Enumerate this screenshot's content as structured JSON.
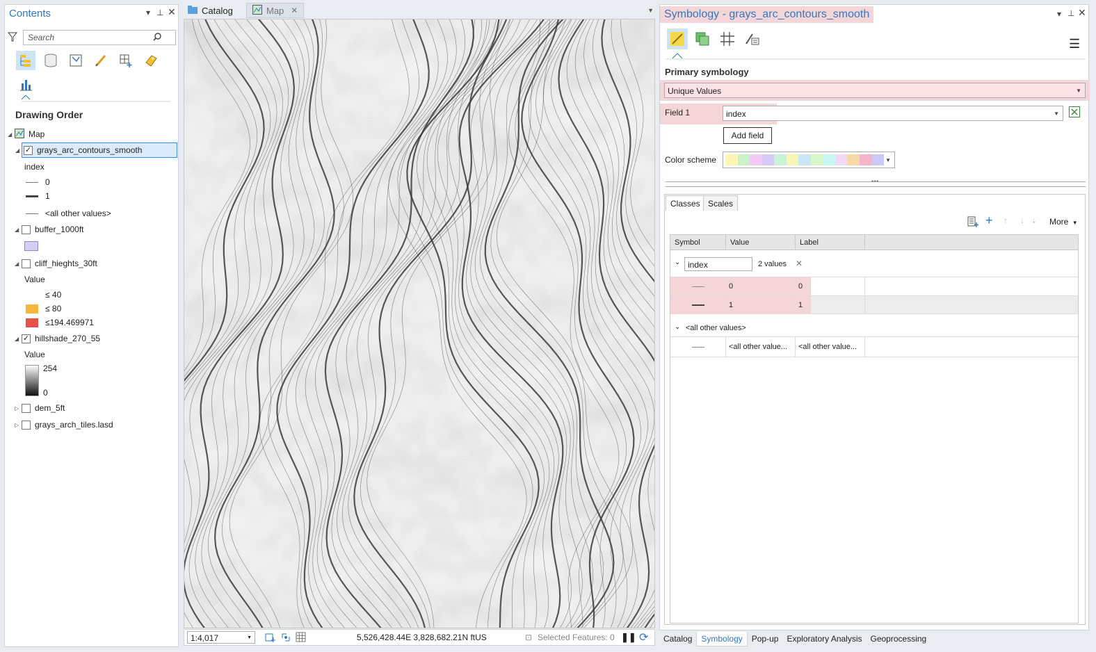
{
  "contents": {
    "title": "Contents",
    "search_placeholder": "Search",
    "section": "Drawing Order",
    "map_label": "Map",
    "layers": {
      "contours": {
        "name": "grays_arc_contours_smooth",
        "field": "index",
        "classes": [
          "0",
          "1",
          "<all other values>"
        ]
      },
      "buffer": {
        "name": "buffer_1000ft",
        "color": "#d4d0f5"
      },
      "cliff": {
        "name": "cliff_hieghts_30ft",
        "field": "Value",
        "classes": [
          {
            "label": "≤ 40",
            "color": "#ffffff"
          },
          {
            "label": "≤ 80",
            "color": "#f5b73c"
          },
          {
            "label": "≤194.469971",
            "color": "#e8504a"
          }
        ]
      },
      "hillshade": {
        "name": "hillshade_270_55",
        "field": "Value",
        "high": "254",
        "low": "0"
      },
      "dem": {
        "name": "dem_5ft"
      },
      "las": {
        "name": "grays_arch_tiles.lasd"
      }
    }
  },
  "doc_tabs": [
    "Catalog",
    "Map"
  ],
  "map_status": {
    "scale": "1:4,017",
    "coords": "5,526,428.44E 3,828,682.21N ftUS",
    "selected": "Selected Features: 0"
  },
  "symbology": {
    "title": "Symbology - grays_arc_contours_smooth",
    "primary_label": "Primary symbology",
    "method": "Unique Values",
    "field1_label": "Field 1",
    "field1_value": "index",
    "add_field": "Add field",
    "color_scheme_label": "Color scheme",
    "color_scheme": [
      "#fff6b3",
      "#c9f2c9",
      "#f2c9f2",
      "#d9c9f7",
      "#c9f2d9",
      "#f7f7b3",
      "#c9e8f7",
      "#d9f7c9",
      "#c9f7f2",
      "#f2d9f7",
      "#f7d9a8",
      "#f7b3c9",
      "#c9c9f7"
    ],
    "tabs": [
      "Classes",
      "Scales"
    ],
    "more": "More",
    "columns": [
      "Symbol",
      "Value",
      "Label"
    ],
    "group_field": "index",
    "group_count": "2 values",
    "rows": [
      {
        "value": "0",
        "label": "0"
      },
      {
        "value": "1",
        "label": "1"
      }
    ],
    "other_header": "<all other values>",
    "other_row": {
      "value": "<all other value...",
      "label": "<all other value..."
    }
  },
  "bottom_tabs": [
    "Catalog",
    "Symbology",
    "Pop-up",
    "Exploratory Analysis",
    "Geoprocessing"
  ]
}
